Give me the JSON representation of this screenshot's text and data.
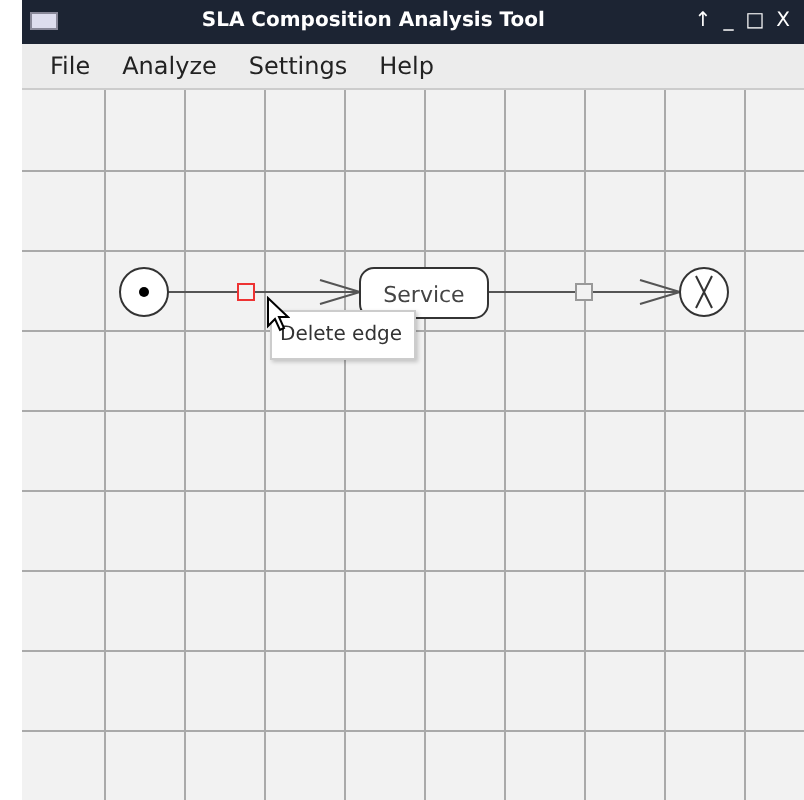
{
  "window": {
    "title": "SLA Composition Analysis Tool",
    "controls": [
      "↑",
      "_",
      "□",
      "X"
    ]
  },
  "menu": [
    "File",
    "Analyze",
    "Settings",
    "Help"
  ],
  "diagram": {
    "nodes": [
      {
        "kind": "start"
      },
      {
        "kind": "service",
        "label": "Service"
      },
      {
        "kind": "end"
      }
    ],
    "edges": [
      {
        "handle_selected": true
      },
      {
        "handle_selected": false
      }
    ]
  },
  "context_menu": {
    "items": [
      "Delete edge"
    ]
  }
}
